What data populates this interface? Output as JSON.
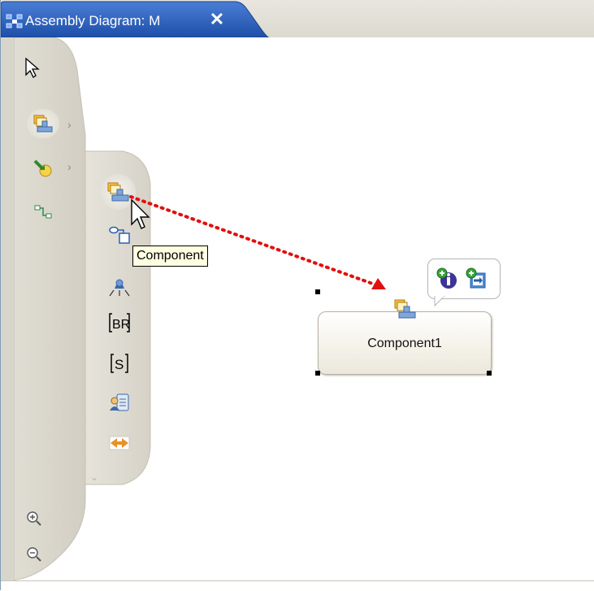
{
  "tab": {
    "title": "Assembly Diagram: M",
    "close_glyph": "✕",
    "icon": "assembly-diagram-icon"
  },
  "palette": {
    "tools": [
      {
        "name": "select-arrow-icon"
      },
      {
        "name": "component-icon"
      },
      {
        "name": "import-icon"
      },
      {
        "name": "wire-icon"
      }
    ],
    "drawer_tools": [
      {
        "name": "component-icon"
      },
      {
        "name": "interface-component-icon"
      },
      {
        "name": "stand-alone-reference-icon"
      },
      {
        "name": "business-rule-icon"
      },
      {
        "name": "state-machine-icon"
      },
      {
        "name": "human-task-icon"
      },
      {
        "name": "interface-map-icon"
      }
    ],
    "zoom": [
      {
        "name": "zoom-in-icon"
      },
      {
        "name": "zoom-out-icon"
      }
    ]
  },
  "tooltip": {
    "text": "Component"
  },
  "canvas": {
    "component": {
      "label": "Component1"
    },
    "hover_actions": [
      {
        "name": "add-interface-icon"
      },
      {
        "name": "add-reference-icon"
      }
    ]
  },
  "colors": {
    "tab_blue": "#2d66c3",
    "drag_arrow": "#e01010",
    "tooltip_bg": "#ffffe1"
  }
}
